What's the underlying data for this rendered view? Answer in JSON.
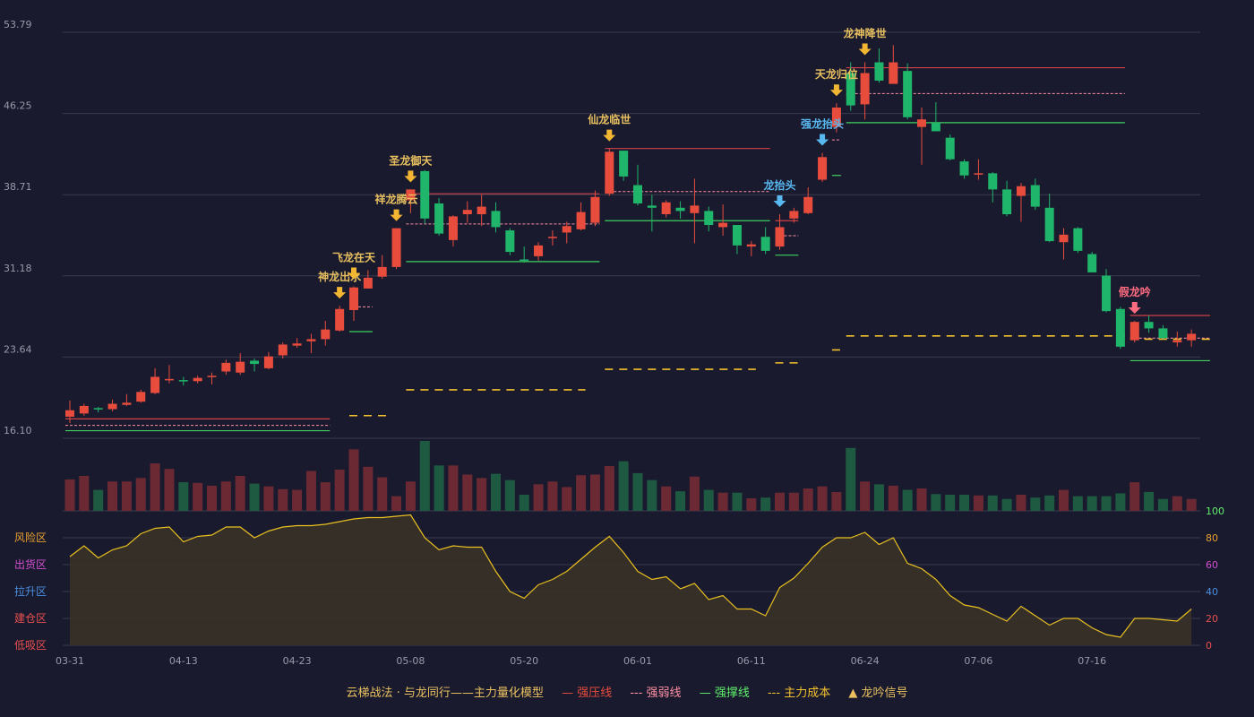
{
  "legend": {
    "model": "云梯战法 · 与龙同行——主力量化模型",
    "strong_resistance": "— 强压线",
    "weak_line": "--- 强弱线",
    "strong_support": "— 强撑线",
    "main_cost": "--- 主力成本",
    "signal": "▲ 龙吟信号"
  },
  "colors": {
    "background": "#1a1a2e",
    "up": "#e84c3d",
    "down": "#1fb56a",
    "vol_up": "#6b2a33",
    "vol_down": "#1e5a42",
    "gold": "#e8c060",
    "blue": "#58b8f0",
    "pink": "#ff6b81",
    "grid": "#3a3a4e"
  },
  "chart_data": {
    "type": "candlestick",
    "price_axis": {
      "ticks": [
        53.79,
        46.25,
        38.71,
        31.18,
        23.64,
        16.1
      ],
      "ylim": [
        16.1,
        53.79
      ]
    },
    "x_ticks": [
      {
        "label": "03-31",
        "i": 0
      },
      {
        "label": "04-13",
        "i": 8
      },
      {
        "label": "04-23",
        "i": 16
      },
      {
        "label": "05-08",
        "i": 24
      },
      {
        "label": "05-20",
        "i": 32
      },
      {
        "label": "06-01",
        "i": 40
      },
      {
        "label": "06-11",
        "i": 48
      },
      {
        "label": "06-24",
        "i": 56
      },
      {
        "label": "07-06",
        "i": 64
      },
      {
        "label": "07-16",
        "i": 72
      }
    ],
    "candles": [
      [
        18.1,
        18.7,
        17.5,
        19.6
      ],
      [
        18.4,
        19.1,
        18.2,
        19.3
      ],
      [
        18.9,
        18.8,
        18.5,
        19.0
      ],
      [
        18.8,
        19.3,
        18.6,
        19.7
      ],
      [
        19.2,
        19.4,
        19.1,
        20.2
      ],
      [
        19.5,
        20.4,
        19.4,
        20.6
      ],
      [
        20.3,
        21.8,
        20.2,
        22.6
      ],
      [
        21.5,
        21.6,
        21.2,
        22.9
      ],
      [
        21.5,
        21.4,
        21.0,
        21.8
      ],
      [
        21.4,
        21.7,
        21.2,
        21.9
      ],
      [
        21.8,
        21.9,
        21.1,
        22.2
      ],
      [
        22.3,
        23.1,
        22.0,
        23.4
      ],
      [
        22.2,
        23.2,
        22.0,
        24.0
      ],
      [
        23.3,
        23.0,
        22.3,
        23.5
      ],
      [
        22.6,
        23.7,
        22.5,
        24.1
      ],
      [
        23.8,
        24.8,
        23.5,
        25.0
      ],
      [
        24.7,
        24.9,
        24.5,
        25.4
      ],
      [
        25.1,
        25.3,
        24.0,
        25.8
      ],
      [
        25.3,
        26.2,
        24.7,
        27.0
      ],
      [
        26.1,
        28.1,
        26.0,
        28.4
      ],
      [
        28.0,
        30.1,
        27.0,
        30.2
      ],
      [
        30.0,
        31.0,
        30.0,
        31.7
      ],
      [
        31.1,
        32.0,
        30.9,
        33.1
      ],
      [
        32.0,
        35.6,
        31.8,
        35.6
      ],
      [
        38.2,
        39.2,
        37.0,
        39.2
      ],
      [
        40.9,
        36.5,
        36.0,
        41.0
      ],
      [
        37.9,
        35.1,
        34.9,
        38.4
      ],
      [
        34.5,
        36.7,
        33.9,
        36.8
      ],
      [
        36.9,
        37.3,
        36.1,
        38.1
      ],
      [
        36.9,
        37.6,
        35.8,
        38.7
      ],
      [
        37.2,
        35.7,
        35.2,
        38.0
      ],
      [
        35.4,
        33.4,
        33.1,
        35.6
      ],
      [
        32.7,
        32.6,
        32.4,
        33.9
      ],
      [
        33.0,
        34.0,
        32.6,
        34.3
      ],
      [
        34.7,
        34.8,
        34.0,
        35.4
      ],
      [
        35.2,
        35.8,
        34.2,
        36.2
      ],
      [
        35.5,
        37.1,
        35.4,
        38.0
      ],
      [
        36.1,
        38.5,
        35.8,
        39.1
      ],
      [
        38.8,
        42.7,
        38.6,
        43.0
      ],
      [
        42.8,
        40.4,
        40.0,
        42.8
      ],
      [
        39.6,
        37.9,
        37.7,
        41.5
      ],
      [
        37.7,
        37.5,
        35.3,
        38.7
      ],
      [
        36.9,
        38.0,
        36.6,
        38.2
      ],
      [
        37.5,
        37.2,
        36.5,
        38.1
      ],
      [
        37.0,
        37.7,
        34.2,
        40.2
      ],
      [
        37.2,
        35.9,
        35.3,
        37.6
      ],
      [
        35.7,
        36.1,
        34.9,
        37.8
      ],
      [
        35.9,
        34.0,
        33.2,
        35.8
      ],
      [
        33.9,
        34.1,
        33.0,
        34.4
      ],
      [
        34.8,
        33.5,
        33.2,
        35.7
      ],
      [
        33.9,
        35.7,
        33.6,
        36.9
      ],
      [
        36.5,
        37.2,
        36.1,
        37.5
      ],
      [
        37.0,
        38.5,
        36.9,
        39.4
      ],
      [
        40.1,
        42.2,
        39.9,
        42.6
      ],
      [
        45.0,
        46.8,
        44.5,
        47.2
      ],
      [
        50.0,
        47.0,
        46.5,
        51.0
      ],
      [
        47.1,
        50.0,
        45.7,
        51.0
      ],
      [
        51.0,
        49.3,
        49.1,
        52.3
      ],
      [
        49.0,
        51.0,
        49.5,
        52.6
      ],
      [
        50.2,
        45.9,
        45.7,
        50.9
      ],
      [
        45.0,
        45.7,
        41.5,
        46.8
      ],
      [
        45.4,
        44.6,
        44.6,
        47.3
      ],
      [
        44.0,
        42.0,
        41.9,
        44.3
      ],
      [
        41.8,
        40.5,
        40.2,
        42.0
      ],
      [
        40.7,
        40.7,
        40.1,
        42.0
      ],
      [
        40.7,
        39.2,
        38.0,
        40.8
      ],
      [
        39.2,
        36.9,
        36.7,
        40.0
      ],
      [
        38.6,
        39.5,
        36.2,
        39.8
      ],
      [
        39.6,
        37.6,
        37.3,
        40.2
      ],
      [
        37.5,
        34.4,
        34.3,
        38.8
      ],
      [
        34.3,
        35.0,
        32.7,
        35.6
      ],
      [
        35.6,
        33.5,
        33.3,
        35.7
      ],
      [
        33.2,
        31.5,
        31.5,
        33.4
      ],
      [
        31.2,
        27.9,
        27.8,
        31.8
      ],
      [
        28.1,
        24.6,
        24.4,
        28.3
      ],
      [
        25.2,
        26.9,
        25.0,
        27.0
      ],
      [
        26.9,
        26.3,
        25.9,
        27.5
      ],
      [
        26.3,
        25.4,
        25.3,
        26.6
      ],
      [
        25.0,
        25.2,
        24.6,
        26.0
      ],
      [
        25.2,
        25.8,
        24.6,
        26.2
      ]
    ],
    "volume_ratio": [
      0.45,
      0.5,
      0.3,
      0.42,
      0.42,
      0.47,
      0.68,
      0.6,
      0.41,
      0.4,
      0.36,
      0.42,
      0.5,
      0.39,
      0.35,
      0.31,
      0.3,
      0.57,
      0.41,
      0.59,
      0.88,
      0.63,
      0.48,
      0.21,
      0.42,
      1.0,
      0.65,
      0.65,
      0.52,
      0.47,
      0.53,
      0.44,
      0.23,
      0.38,
      0.42,
      0.34,
      0.51,
      0.52,
      0.64,
      0.71,
      0.54,
      0.44,
      0.35,
      0.28,
      0.49,
      0.3,
      0.26,
      0.26,
      0.18,
      0.19,
      0.26,
      0.26,
      0.32,
      0.35,
      0.27,
      0.9,
      0.42,
      0.38,
      0.36,
      0.3,
      0.32,
      0.24,
      0.23,
      0.23,
      0.22,
      0.22,
      0.17,
      0.23,
      0.19,
      0.22,
      0.3,
      0.21,
      0.21,
      0.21,
      0.25,
      0.41,
      0.27,
      0.17,
      0.21,
      0.17
    ],
    "indicator": {
      "ylim": [
        0,
        100
      ],
      "ticks": [
        0,
        20,
        40,
        60,
        80,
        100
      ],
      "zones": [
        "风险区",
        "出货区",
        "拉升区",
        "建仓区",
        "低吸区"
      ],
      "values": [
        66,
        74,
        65,
        71,
        74,
        83,
        87,
        88,
        77,
        81,
        82,
        88,
        88,
        80,
        85,
        88,
        89,
        89,
        90,
        92,
        94,
        95,
        95,
        96,
        97,
        80,
        71,
        74,
        73,
        73,
        55,
        40,
        35,
        45,
        49,
        55,
        64,
        73,
        81,
        69,
        55,
        49,
        51,
        42,
        46,
        34,
        37,
        27,
        27,
        22,
        43,
        50,
        61,
        73,
        80,
        80,
        84,
        75,
        80,
        61,
        57,
        49,
        37,
        30,
        28,
        23,
        18,
        29,
        22,
        15,
        20,
        20,
        13,
        8,
        6,
        20,
        20,
        19,
        18,
        27
      ]
    },
    "levels": [
      {
        "type": "strong_resistance",
        "start": 0,
        "end": 18,
        "value": 17.9
      },
      {
        "type": "weak",
        "start": 0,
        "end": 18,
        "value": 17.3
      },
      {
        "type": "strong_support",
        "start": 0,
        "end": 18,
        "value": 16.8
      },
      {
        "type": "weak",
        "start": 20,
        "end": 21,
        "value": 28.3
      },
      {
        "type": "strong_support",
        "start": 20,
        "end": 21,
        "value": 26.0
      },
      {
        "type": "cost",
        "start": 20,
        "end": 22,
        "value": 18.2
      },
      {
        "type": "strong_resistance",
        "start": 24,
        "end": 37,
        "value": 38.8
      },
      {
        "type": "weak",
        "start": 24,
        "end": 37,
        "value": 36.0
      },
      {
        "type": "strong_support",
        "start": 24,
        "end": 37,
        "value": 32.5
      },
      {
        "type": "cost",
        "start": 24,
        "end": 36,
        "value": 20.6
      },
      {
        "type": "strong_resistance",
        "start": 38,
        "end": 49,
        "value": 43.0
      },
      {
        "type": "weak",
        "start": 38,
        "end": 49,
        "value": 39.0
      },
      {
        "type": "strong_support",
        "start": 38,
        "end": 49,
        "value": 36.3
      },
      {
        "type": "cost",
        "start": 38,
        "end": 48,
        "value": 22.5
      },
      {
        "type": "strong_resistance",
        "start": 50,
        "end": 51,
        "value": 36.3
      },
      {
        "type": "weak",
        "start": 50,
        "end": 51,
        "value": 34.9
      },
      {
        "type": "strong_support",
        "start": 50,
        "end": 51,
        "value": 33.1
      },
      {
        "type": "cost",
        "start": 50,
        "end": 51,
        "value": 23.1
      },
      {
        "type": "weak",
        "start": 54,
        "end": 54,
        "value": 43.8
      },
      {
        "type": "strong_support",
        "start": 54,
        "end": 54,
        "value": 40.5
      },
      {
        "type": "cost",
        "start": 54,
        "end": 54,
        "value": 24.3
      },
      {
        "type": "strong_resistance",
        "start": 55,
        "end": 74,
        "value": 50.5
      },
      {
        "type": "weak",
        "start": 55,
        "end": 74,
        "value": 48.1
      },
      {
        "type": "strong_support",
        "start": 55,
        "end": 74,
        "value": 45.4
      },
      {
        "type": "cost",
        "start": 55,
        "end": 74,
        "value": 25.6
      },
      {
        "type": "strong_resistance",
        "start": 75,
        "end": 80,
        "value": 27.5
      },
      {
        "type": "weak",
        "start": 75,
        "end": 80,
        "value": 25.4
      },
      {
        "type": "strong_support",
        "start": 75,
        "end": 80,
        "value": 23.3
      },
      {
        "type": "cost",
        "start": 75,
        "end": 80,
        "value": 25.3
      }
    ],
    "signals": [
      {
        "i": 19,
        "label": "神龙出水",
        "color": "gold"
      },
      {
        "i": 20,
        "label": "飞龙在天",
        "color": "gold"
      },
      {
        "i": 23,
        "label": "祥龙腾云",
        "color": "gold"
      },
      {
        "i": 24,
        "label": "圣龙御天",
        "color": "gold"
      },
      {
        "i": 38,
        "label": "仙龙临世",
        "color": "gold"
      },
      {
        "i": 50,
        "label": "龙抬头",
        "color": "blue"
      },
      {
        "i": 53,
        "label": "强龙抬头",
        "color": "blue"
      },
      {
        "i": 54,
        "label": "天龙归位",
        "color": "gold"
      },
      {
        "i": 56,
        "label": "龙神降世",
        "color": "gold"
      },
      {
        "i": 75,
        "label": "假龙吟",
        "color": "pink"
      }
    ]
  }
}
